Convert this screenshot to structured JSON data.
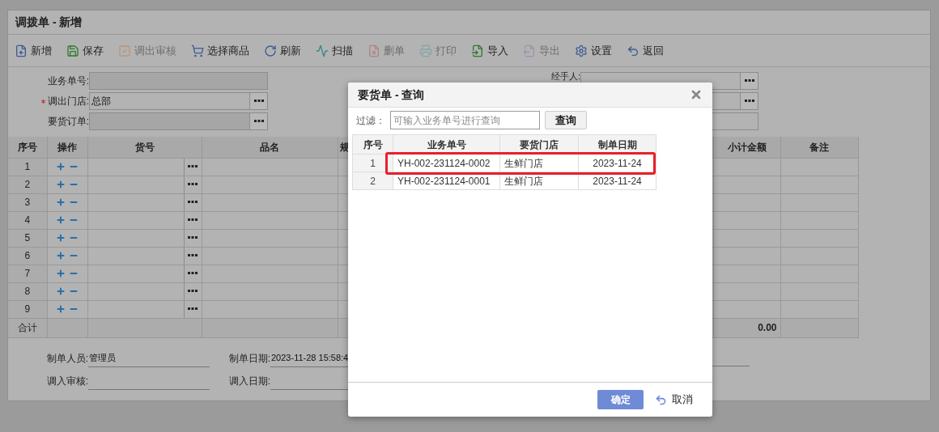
{
  "window": {
    "title": "调拨单 - 新增"
  },
  "toolbar": [
    {
      "kind": "new",
      "label": "新增",
      "disabled": false
    },
    {
      "kind": "save",
      "label": "保存",
      "disabled": false
    },
    {
      "kind": "approve",
      "label": "调出审核",
      "disabled": true
    },
    {
      "kind": "cart",
      "label": "选择商品",
      "disabled": false
    },
    {
      "kind": "refresh",
      "label": "刷新",
      "disabled": false
    },
    {
      "kind": "scan",
      "label": "扫描",
      "disabled": false
    },
    {
      "kind": "delete",
      "label": "删单",
      "disabled": true
    },
    {
      "kind": "print",
      "label": "打印",
      "disabled": true
    },
    {
      "kind": "import",
      "label": "导入",
      "disabled": false
    },
    {
      "kind": "export",
      "label": "导出",
      "disabled": true
    },
    {
      "kind": "settings",
      "label": "设置",
      "disabled": false
    },
    {
      "kind": "back",
      "label": "返回",
      "disabled": false
    }
  ],
  "form_left": [
    {
      "label": "业务单号:",
      "kind": "readonly",
      "required": false
    },
    {
      "label": "调出门店:",
      "kind": "picker",
      "required": true,
      "value": "总部"
    },
    {
      "label": "要货订单:",
      "kind": "picker_readonly",
      "required": false
    }
  ],
  "form_right": [
    {
      "label": "经手人:",
      "kind": "picker"
    },
    {
      "kind": "picker"
    },
    {
      "kind": "text"
    }
  ],
  "table": {
    "columns": [
      "序号",
      "操作",
      "货号",
      "品名",
      "规",
      "小计金额",
      "备注"
    ],
    "rows": [
      "1",
      "2",
      "3",
      "4",
      "5",
      "6",
      "7",
      "8",
      "9"
    ],
    "total": {
      "label": "合计",
      "subtotal": "0.00"
    }
  },
  "footer": [
    {
      "label": "制单人员:",
      "value": "管理员"
    },
    {
      "label": "制单日期:",
      "value": "2023-11-28 15:58:4"
    },
    {
      "label": "调入审核:"
    },
    {
      "label": "调入日期:"
    }
  ],
  "dialog": {
    "title": "要货单 - 查询",
    "filter": {
      "label": "过滤：",
      "placeholder": "可输入业务单号进行查询",
      "button": "查询"
    },
    "columns": [
      "序号",
      "业务单号",
      "要货门店",
      "制单日期"
    ],
    "rows": [
      {
        "index": "1",
        "number": "YH-002-231124-0002",
        "store": "生鲜门店",
        "date": "2023-11-24",
        "selected": true
      },
      {
        "index": "2",
        "number": "YH-002-231124-0001",
        "store": "生鲜门店",
        "date": "2023-11-24",
        "selected": false
      }
    ],
    "confirm": "确定",
    "cancel": "取消"
  }
}
